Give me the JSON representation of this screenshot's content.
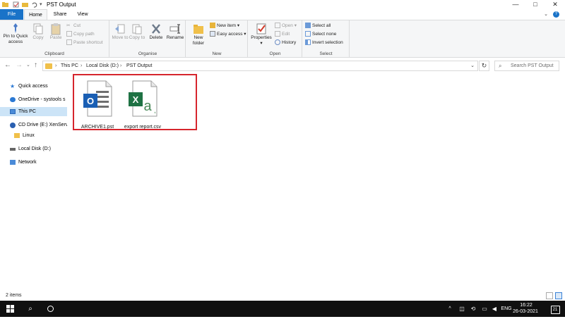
{
  "window": {
    "title": "PST Output",
    "controls": {
      "minimize": "—",
      "maximize": "□",
      "close": "✕"
    }
  },
  "tabs": {
    "file": "File",
    "home": "Home",
    "share": "Share",
    "view": "View"
  },
  "ribbon": {
    "clipboard": {
      "pin": "Pin to Quick access",
      "copy": "Copy",
      "paste": "Paste",
      "cut": "Cut",
      "copy_path": "Copy path",
      "paste_shortcut": "Paste shortcut",
      "label": "Clipboard"
    },
    "organise": {
      "move_to": "Move to",
      "copy_to": "Copy to",
      "delete": "Delete",
      "rename": "Rename",
      "label": "Organise"
    },
    "new": {
      "new_folder": "New folder",
      "new_item": "New item",
      "easy_access": "Easy access",
      "label": "New"
    },
    "open": {
      "properties": "Properties",
      "open": "Open",
      "edit": "Edit",
      "history": "History",
      "label": "Open"
    },
    "select": {
      "select_all": "Select all",
      "select_none": "Select none",
      "invert_selection": "Invert selection",
      "label": "Select"
    }
  },
  "address": {
    "crumbs": [
      "This PC",
      "Local Disk (D:)",
      "PST Output"
    ],
    "search_placeholder": "Search PST Output"
  },
  "nav": {
    "quick_access": "Quick access",
    "onedrive": "OneDrive - systools s",
    "this_pc": "This PC",
    "cd_drive": "CD Drive (E:) XenServ",
    "linux": "Linux",
    "local_disk": "Local Disk (D:)",
    "network": "Network"
  },
  "files": [
    {
      "name": "ARCHIVE1.pst",
      "icon": "outlook-pst-file-icon",
      "badge": "O"
    },
    {
      "name": "export report.csv",
      "icon": "excel-csv-file-icon",
      "badge": "X"
    }
  ],
  "status": {
    "item_count": "2 items"
  },
  "taskbar": {
    "time": "16:22",
    "date": "26-03-2021",
    "language": "ENG",
    "notification_count": "21"
  },
  "colors": {
    "accent": "#1a73c8",
    "highlight_border": "#d6252d",
    "selected_nav": "#cce4f7"
  }
}
